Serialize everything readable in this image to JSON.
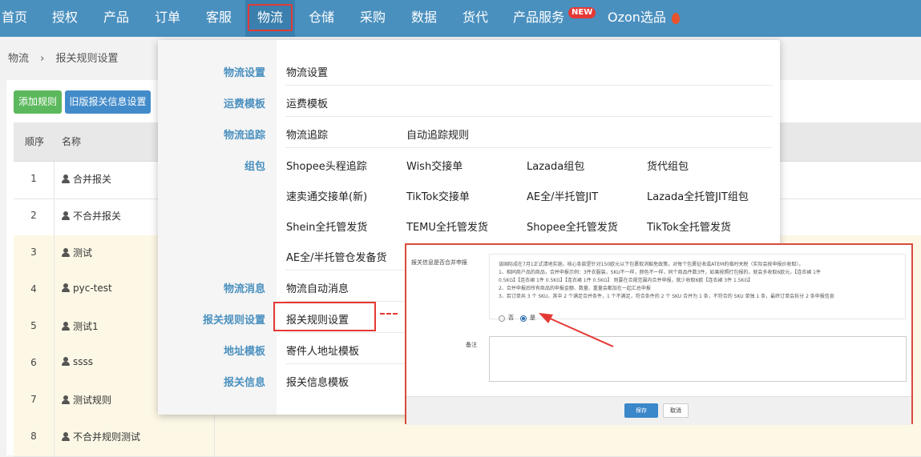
{
  "topnav": {
    "items": [
      "首页",
      "授权",
      "产品",
      "订单",
      "客服",
      "物流",
      "仓储",
      "采购",
      "数据",
      "货代",
      "产品服务",
      "Ozon选品"
    ],
    "badge": "NEW",
    "fire_icon": "fire-icon"
  },
  "breadcrumb": [
    "物流",
    "报关规则设置"
  ],
  "toolbar": {
    "add_rule": "添加规则",
    "old_settings": "旧版报关信息设置"
  },
  "table": {
    "headers": [
      "顺序",
      "名称"
    ],
    "rows": [
      {
        "num": "1",
        "name": "合并报关"
      },
      {
        "num": "2",
        "name": "不合并报关"
      },
      {
        "num": "3",
        "name": "测试"
      },
      {
        "num": "4",
        "name": "pyc-test"
      },
      {
        "num": "5",
        "name": "测试1"
      },
      {
        "num": "6",
        "name": "ssss"
      },
      {
        "num": "7",
        "name": "测试规则"
      },
      {
        "num": "8",
        "name": "不合并规则测试"
      }
    ]
  },
  "dropdown": {
    "categories": [
      "物流设置",
      "运费模板",
      "物流追踪",
      "组包",
      "物流消息",
      "报关规则设置",
      "地址模板",
      "报关信息"
    ],
    "links": {
      "logistics_settings": "物流设置",
      "freight_template": "运费模板",
      "tracking": [
        "物流追踪",
        "自动追踪规则"
      ],
      "package": [
        [
          "Shopee头程追踪",
          "Wish交接单",
          "Lazada组包",
          "货代组包"
        ],
        [
          "速卖通交接单(新)",
          "TikTok交接单",
          "AE全/半托管JIT",
          "Lazada全托管JIT组包"
        ],
        [
          "Shein全托管发货",
          "TEMU全托管发货",
          "Shopee全托管发货",
          "TikTok全托管发货"
        ],
        [
          "AE全/半托管仓发备货"
        ]
      ],
      "message": "物流自动消息",
      "customs_rule": "报关规则设置",
      "address": "寄件人地址模板",
      "customs_info": "报关信息模板"
    }
  },
  "inset": {
    "merge_label": "报关信息是否合并申报",
    "desc": [
      "该国际成在7月1正式清地实施，核心条款是针对150欧元以下包裹取消豁免政策，对每个包裹征收或ATEM的临时关税（实际会按申报价收取）。",
      "1、相同商户品的商品，合并申报示例：3件衣服装，SKU不一样，颜色不一样，同个商品件数3件，如果按照打包报的，就会多收取6欧元，【连衣裙 1件",
      "0.5KG】【连衣裙 1件 0.5KG】【连衣裙 1件 0.5KG】 则要在合规范围内合并申报，就少收取6欧【连衣裙 3件 1.5KG】",
      "2、合并申报后所有商品的申报金额、数量、重量会都加在一起汇总申报",
      "3、若订单共 3 个 SKU，其中 2 个满足合并条件，1 个不满足，符合条件的 2 个 SKU 合并为 1 条，不符合的 SKU 单独 1 条，最终订单会拆分 2 条申报信息"
    ],
    "radio_no": "否",
    "radio_yes": "是",
    "remark_label": "备注",
    "save": "保存",
    "cancel": "取消"
  }
}
